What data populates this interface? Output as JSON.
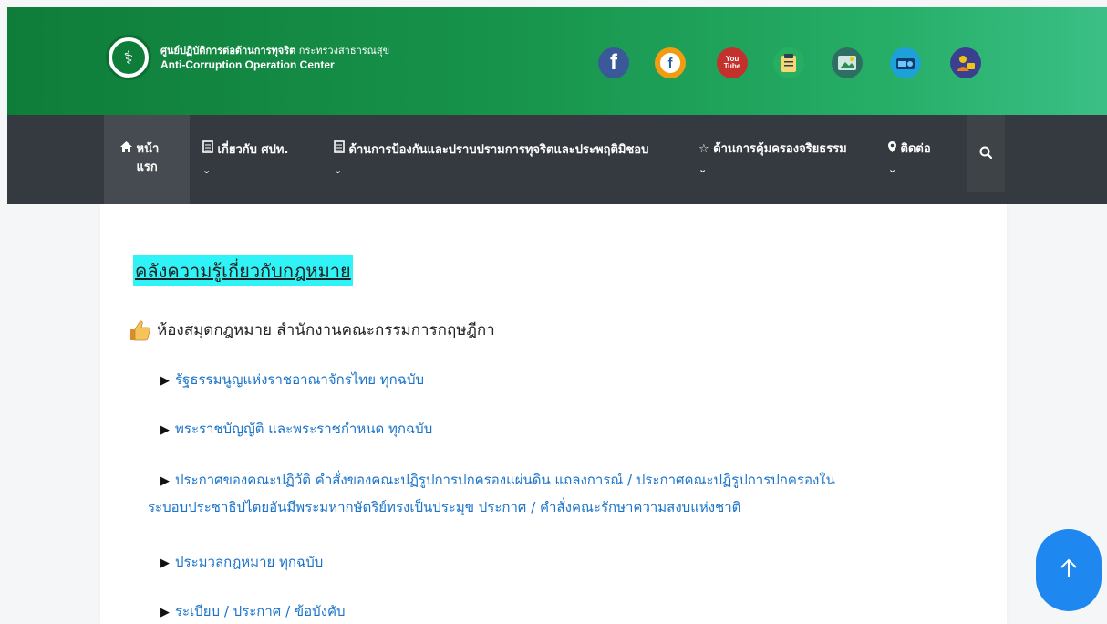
{
  "header": {
    "org_name_bold": "ศูนย์ปฏิบัติการต่อต้านการทุจริต",
    "org_ministry": "กระทรวงสาธารณสุข",
    "org_name_en": "Anti-Corruption Operation Center",
    "social": [
      {
        "name": "facebook-icon",
        "glyph": "f",
        "color": "#3b5998"
      },
      {
        "name": "facebook-alt-icon",
        "glyph": "f",
        "color": "#f39c12"
      },
      {
        "name": "youtube-icon",
        "glyph": "You Tube",
        "color": "#c4302b"
      },
      {
        "name": "clipboard-icon",
        "glyph": "",
        "color": "#27ae60"
      },
      {
        "name": "photo-gallery-icon",
        "glyph": "",
        "color": "#2f6f63"
      },
      {
        "name": "radio-icon",
        "glyph": "",
        "color": "#1ea1d9"
      },
      {
        "name": "users-lock-icon",
        "glyph": "",
        "color": "#3a3f8f"
      }
    ]
  },
  "nav": {
    "items": [
      {
        "label": "หน้า แรก",
        "icon": "home-icon",
        "has_dropdown": false
      },
      {
        "label": "เกี่ยวกับ ศปท.",
        "icon": "document-icon",
        "has_dropdown": true
      },
      {
        "label": "ด้านการป้องกันและปราบปรามการทุจริตและประพฤติมิชอบ",
        "icon": "document-icon",
        "has_dropdown": true
      },
      {
        "label": "ด้านการคุ้มครองจริยธรรม",
        "icon": "star-icon",
        "has_dropdown": true
      },
      {
        "label": "ติดต่อ",
        "icon": "map-marker-icon",
        "has_dropdown": true
      }
    ],
    "search_icon": "search-icon"
  },
  "main": {
    "title": "คลังความรู้เกี่ยวกับกฎหมาย",
    "subheading": "ห้องสมุดกฎหมาย สำนักงานคณะกรรมการกฤษฎีกา",
    "links": [
      "รัฐธรรมนูญแห่งราชอาณาจักรไทย ทุกฉบับ",
      "พระราชบัญญัติ และพระราชกำหนด ทุกฉบับ",
      "ประกาศของคณะปฏิวัติ คำสั่งของคณะปฏิรูปการปกครองแผ่นดิน แถลงการณ์ / ประกาศคณะปฏิรูปการปกครองใน",
      "ระบอบประชาธิปไตยอันมีพระมหากษัตริย์ทรงเป็นประมุข ประกาศ / คำสั่งคณะรักษาความสงบแห่งชาติ",
      "ประมวลกฎหมาย ทุกฉบับ",
      "ระเบียบ / ประกาศ / ข้อบังคับ"
    ]
  },
  "colors": {
    "header_gradient_start": "#0f7d3a",
    "header_gradient_end": "#3bbf86",
    "nav_bg": "#353a40",
    "link": "#1a73c9",
    "title_highlight": "#2ff3f6",
    "fab": "#1e88f0"
  },
  "fab": {
    "icon": "arrow-up-icon"
  }
}
